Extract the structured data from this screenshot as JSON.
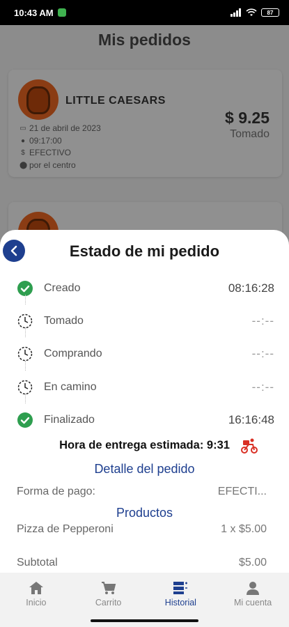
{
  "status_bar": {
    "time": "10:43 AM",
    "battery": "87"
  },
  "background": {
    "title": "Mis pedidos",
    "order": {
      "store": "LITTLE CAESARS",
      "date": "21 de abril de 2023",
      "time": "09:17:00",
      "payment": "EFECTIVO",
      "location": "por el centro",
      "price": "$ 9.25",
      "status": "Tomado"
    }
  },
  "sheet": {
    "title": "Estado de mi pedido",
    "steps": [
      {
        "label": "Creado",
        "time": "08:16:28",
        "state": "done"
      },
      {
        "label": "Tomado",
        "time": "--:--",
        "state": "pending"
      },
      {
        "label": "Comprando",
        "time": "--:--",
        "state": "pending"
      },
      {
        "label": "En camino",
        "time": "--:--",
        "state": "pending"
      },
      {
        "label": "Finalizado",
        "time": "16:16:48",
        "state": "done"
      }
    ],
    "eta": "Hora de entrega estimada: 9:31",
    "detail_link": "Detalle del pedido",
    "payment_label": "Forma de pago:",
    "payment_value": "EFECTI...",
    "products_link": "Productos",
    "product_name": "Pizza de Pepperoni",
    "product_value": "1 x $5.00",
    "subtotal_label": "Subtotal",
    "subtotal_value": "$5.00"
  },
  "nav": [
    {
      "label": "Inicio",
      "icon": "home-icon"
    },
    {
      "label": "Carrito",
      "icon": "cart-icon"
    },
    {
      "label": "Historial",
      "icon": "history-icon"
    },
    {
      "label": "Mi cuenta",
      "icon": "account-icon"
    }
  ],
  "colors": {
    "accent": "#1e3f8f",
    "success": "#2e9e4f",
    "delivery": "#d93025"
  }
}
